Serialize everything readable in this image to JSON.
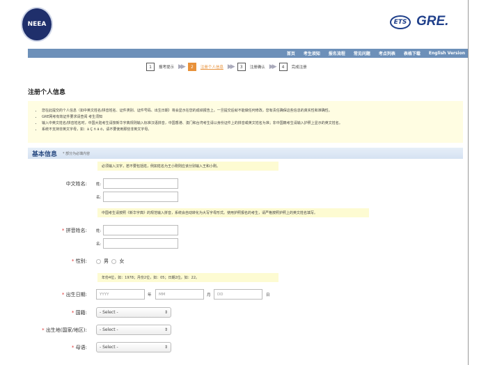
{
  "header": {
    "logo_left": "NEEA",
    "logo_ets": "ETS",
    "logo_gre": "GRE."
  },
  "nav": [
    "首页",
    "考生须知",
    "报名流程",
    "常见问题",
    "考点列表",
    "表格下载",
    "English Version"
  ],
  "steps": [
    {
      "num": "1",
      "label": "报考提示"
    },
    {
      "num": "2",
      "label": "注册个人信息"
    },
    {
      "num": "3",
      "label": "注册确认"
    },
    {
      "num": "4",
      "label": "完成注册"
    }
  ],
  "page_title": "注册个人信息",
  "notices": [
    "您在此提交的个人信息（如中英文姓名/拼音姓名、证件类别、证件号码、出生日期）将会显示在您的成绩报告上。一旦提交后就不能做任何修改。您有责任确保这些信息的真实性和准确性。",
    "GRE网考有效证件要求请查阅 考生须知",
    "输入中英文姓名/拼音姓名时，中国大陆考生请按新华字典规则输入标准汉语拼音，中国香港、澳门和台湾考生请以身份证件上的拼音或英文姓名为准；非中国籍考生请输入护照上显示的英文姓名。",
    "系统不支持非英文字母，如：à Ç ñ ä ö，请不要使用那些非英文字母。"
  ],
  "section": {
    "title": "基本信息",
    "note": "* 部分为必填内容"
  },
  "form": {
    "hint_chinese": "必须输入汉字，若不要包括姓，例如姓名为王小刚则应该分别输入王和小刚。",
    "chinese_name_label": "中文姓名:",
    "surname": "姓:",
    "given": "名:",
    "hint_pinyin": "中国考生请按照《新华字典》的规范输入拼音，系统会自动转化为大写字母形式。使用护照报名的考生，请严格按照护照上的英文姓名填写。",
    "pinyin_name_label": "拼音姓名:",
    "gender_label": "性别:",
    "male": "男",
    "female": "女",
    "hint_dob": "年份4位，如：1978；月份2位，如：05；日期2位，如：22。",
    "dob_label": "出生日期:",
    "year_ph": "YYYY",
    "year": "年",
    "month_ph": "MM",
    "month": "月",
    "day_ph": "DD",
    "day": "日",
    "nationality_label": "国籍:",
    "birthplace_label": "出生地(国家/地区):",
    "language_label": "母语:",
    "select_default": "- Select -",
    "required_mark": "*"
  }
}
